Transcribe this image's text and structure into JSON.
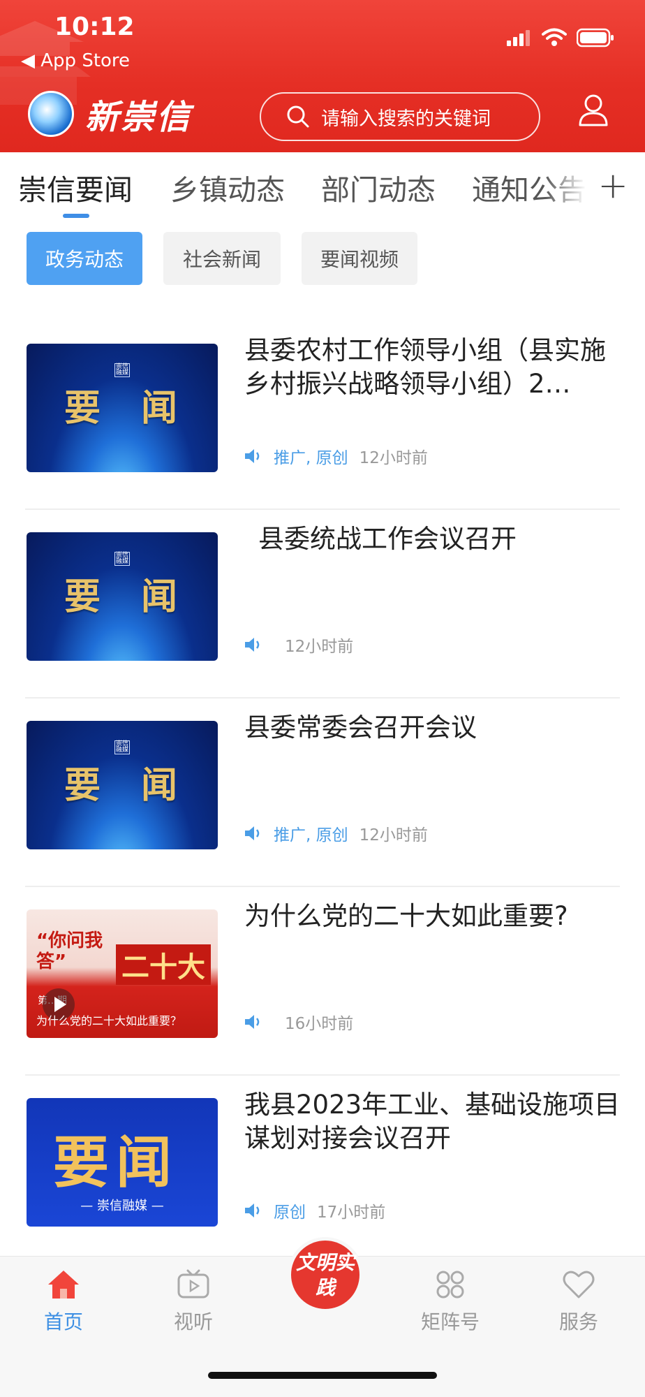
{
  "status_bar": {
    "time": "10:12",
    "back_label": "◀ App Store"
  },
  "header": {
    "app_name": "新崇信",
    "search_placeholder": "请输入搜索的关键词",
    "colors": {
      "bar": "#e52f25"
    }
  },
  "tabs": [
    {
      "label": "崇信要闻",
      "active": true
    },
    {
      "label": "乡镇动态",
      "active": false
    },
    {
      "label": "部门动态",
      "active": false
    },
    {
      "label": "通知公告",
      "active": false
    }
  ],
  "subtabs": [
    {
      "label": "政务动态",
      "active": true
    },
    {
      "label": "社会新闻",
      "active": false
    },
    {
      "label": "要闻视频",
      "active": false
    }
  ],
  "thumb_text": {
    "big_left": "要",
    "big_right": "闻",
    "brand": "崇信融媒",
    "video_caption": "为什么党的二十大如此重要？",
    "video_badge": "“你问我答”",
    "video_big": "二十大",
    "video_episode": "第…期",
    "banner_big": "要闻",
    "banner_caption": "— 崇信融媒 —"
  },
  "news": [
    {
      "title": "县委农村工作领导小组（县实施乡村振兴战略领导小组）2…",
      "tags": "推广, 原创",
      "time": "12小时前"
    },
    {
      "title": "县委统战工作会议召开",
      "tags": "",
      "time": "12小时前"
    },
    {
      "title": "县委常委会召开会议",
      "tags": "推广, 原创",
      "time": "12小时前"
    },
    {
      "title": "为什么党的二十大如此重要?",
      "tags": "",
      "time": "16小时前"
    },
    {
      "title": "我县2023年工业、基础设施项目谋划对接会议召开",
      "tags": "原创",
      "time": "17小时前"
    }
  ],
  "bottom_nav": {
    "items": [
      {
        "label": "首页",
        "icon": "home-icon",
        "active": true
      },
      {
        "label": "视听",
        "icon": "tv-icon",
        "active": false
      },
      {
        "label": "矩阵号",
        "icon": "grid-icon",
        "active": false
      },
      {
        "label": "服务",
        "icon": "heart-icon",
        "active": false
      }
    ],
    "center_label": "文明实践"
  }
}
